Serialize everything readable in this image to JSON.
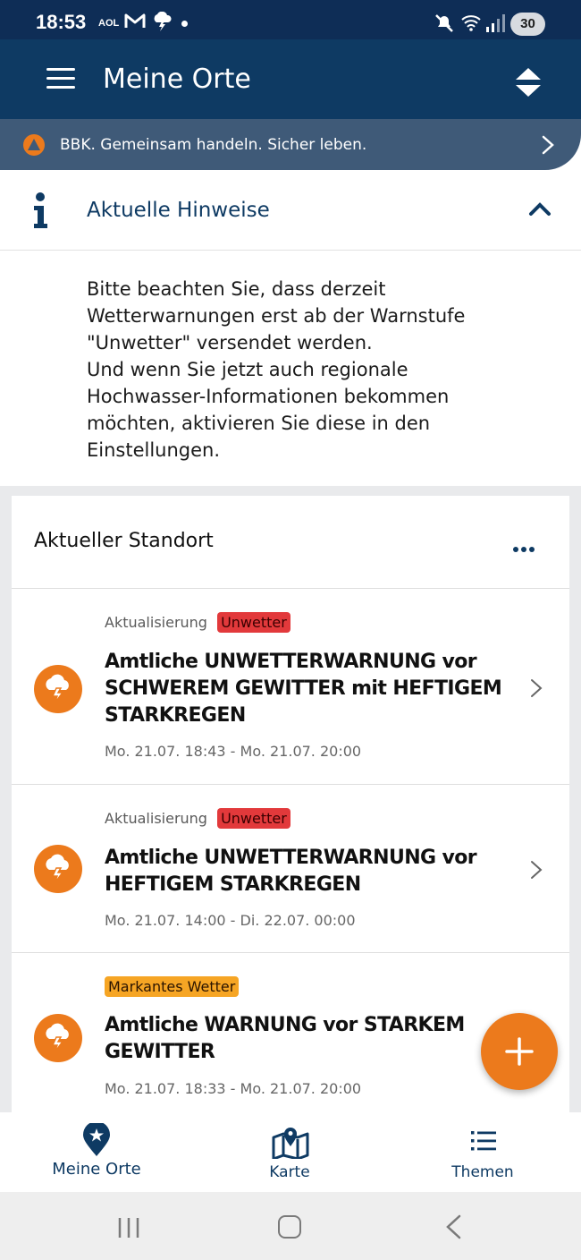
{
  "status_bar": {
    "time": "18:53",
    "aol_label": "AOL",
    "battery": "30"
  },
  "app_bar": {
    "title": "Meine Orte",
    "menu_icon": "hamburger-menu-icon",
    "sort_icon": "sort-updown-icon"
  },
  "banner": {
    "text": "BBK. Gemeinsam handeln. Sicher leben."
  },
  "notices": {
    "title": "Aktuelle Hinweise",
    "body": "Bitte beachten Sie, dass derzeit\nWetterwarnungen erst ab der Warnstufe\n\"Unwetter\" versendet werden.\nUnd wenn Sie jetzt auch regionale\nHochwasser-Informationen bekommen\nmöchten, aktivieren Sie diese in den\nEinstellungen."
  },
  "location_card": {
    "title": "Aktueller Standort",
    "warnings": [
      {
        "meta": "Aktualisierung",
        "badge": "Unwetter",
        "headline": "Amtliche UNWETTERWARNUNG vor SCHWEREM GEWITTER mit HEFTIGEM STARKREGEN",
        "dates": "Mo. 21.07. 18:43 - Mo. 21.07. 20:00"
      },
      {
        "meta": "Aktualisierung",
        "badge": "Unwetter",
        "headline": "Amtliche UNWETTERWARNUNG vor HEFTIGEM STARKREGEN",
        "dates": "Mo. 21.07. 14:00 - Di. 22.07. 00:00"
      },
      {
        "meta": "",
        "badge": "Markantes Wetter",
        "headline": "Amtliche WARNUNG vor STARKEM GEWITTER",
        "dates": "Mo. 21.07. 18:33 - Mo. 21.07. 20:00"
      }
    ]
  },
  "bottom_nav": {
    "items": [
      {
        "label": "Meine Orte",
        "icon": "location-star-icon"
      },
      {
        "label": "Karte",
        "icon": "map-icon"
      },
      {
        "label": "Themen",
        "icon": "list-icon"
      }
    ]
  },
  "colors": {
    "primary": "#0e3a63",
    "banner": "#3f5a78",
    "accent_orange": "#ec7a1c",
    "badge_red": "#e2393b",
    "badge_orange": "#f6a524"
  }
}
